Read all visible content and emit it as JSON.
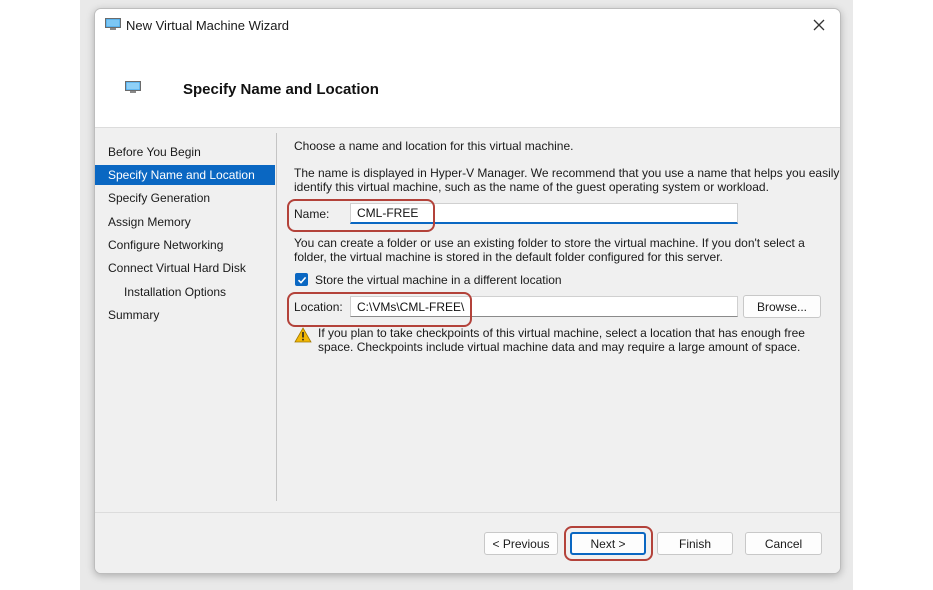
{
  "window": {
    "title": "New Virtual Machine Wizard"
  },
  "header": {
    "title": "Specify Name and Location"
  },
  "sidebar": {
    "items": [
      {
        "label": "Before You Begin"
      },
      {
        "label": "Specify Name and Location"
      },
      {
        "label": "Specify Generation"
      },
      {
        "label": "Assign Memory"
      },
      {
        "label": "Configure Networking"
      },
      {
        "label": "Connect Virtual Hard Disk"
      },
      {
        "label": "Installation Options"
      },
      {
        "label": "Summary"
      }
    ],
    "active_label": "Specify Name and Location"
  },
  "content": {
    "intro": "Choose a name and location for this virtual machine.",
    "desc_line1": "The name is displayed in Hyper-V Manager. We recommend that you use a name that helps you easily",
    "desc_line2": "identify this virtual machine, such as the name of the guest operating system or workload.",
    "name_label": "Name:",
    "name_value": "CML-FREE",
    "folder_line1": "You can create a folder or use an existing folder to store the virtual machine. If you don't select a",
    "folder_line2": "folder, the virtual machine is stored in the default folder configured for this server.",
    "store_checkbox_label": "Store the virtual machine in a different location",
    "store_checked": true,
    "location_label": "Location:",
    "location_value": "C:\\VMs\\CML-FREE\\",
    "browse_label": "Browse...",
    "warning_line1": "If you plan to take checkpoints of this virtual machine, select a location that has enough free",
    "warning_line2": "space. Checkpoints include virtual machine data and may require a large amount of space."
  },
  "footer": {
    "previous_label": "< Previous",
    "next_label": "Next >",
    "finish_label": "Finish",
    "cancel_label": "Cancel"
  },
  "colors": {
    "accent": "#0a67c2",
    "highlight": "#b3423a",
    "warning": "#f2b705"
  },
  "icons": {
    "app": "vm-monitor-icon",
    "close": "close-icon",
    "checkbox": "checkmark-icon",
    "warning": "warning-icon"
  }
}
